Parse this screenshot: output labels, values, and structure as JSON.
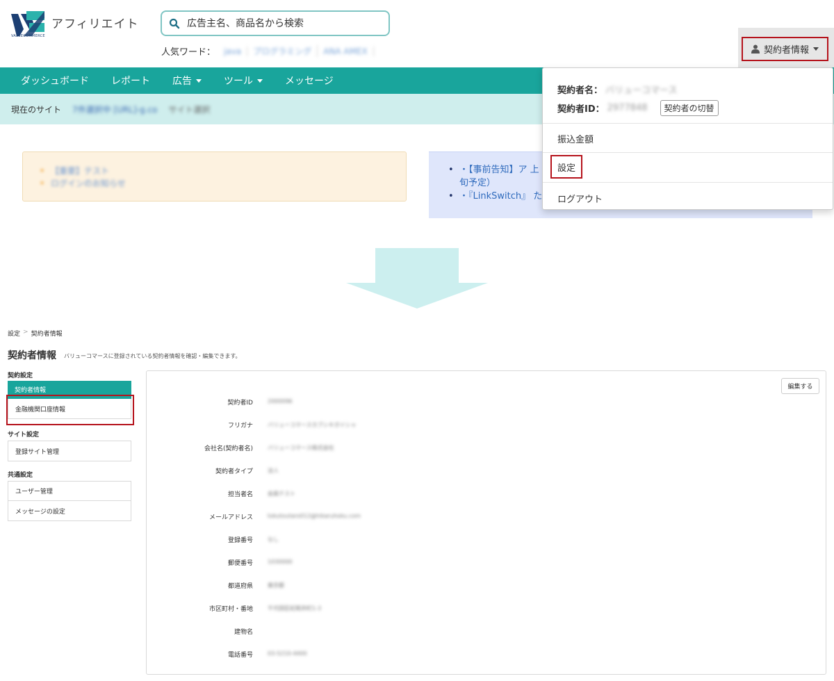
{
  "header": {
    "logo_text": "アフィリエイト",
    "logo_sub": "VALUECOMMERCE",
    "search_placeholder": "広告主名、商品名から検索",
    "popular_label": "人気ワード：",
    "popular_words": [
      "java",
      "プログラミング",
      "ANA AMEX"
    ],
    "account_label": "契約者情報"
  },
  "nav": {
    "items": [
      "ダッシュボード",
      "レポート",
      "広告",
      "ツール",
      "メッセージ"
    ]
  },
  "sitebar": {
    "label": "現在のサイト",
    "site_name": "7件選択中  [URL]-g.co",
    "site_select": "サイト選択"
  },
  "notices_left": [
    "【重要】テスト",
    "ログインのお知らせ"
  ],
  "notices_right": [
    "・【事前告知】ア 上旬予定）",
    "・『LinkSwitch』 た"
  ],
  "dropdown": {
    "name_label": "契約者名：",
    "name_value": "バリューコマース",
    "id_label": "契約者ID：",
    "id_value": "2977848",
    "switch_label": "契約者の切替",
    "transfer": "振込金額",
    "settings": "設定",
    "logout": "ログアウト"
  },
  "breadcrumb": {
    "root": "設定",
    "sep": ">",
    "current": "契約者情報"
  },
  "page": {
    "title": "契約者情報",
    "description": "バリューコマースに登録されている契約者情報を確認・編集できます。"
  },
  "sidebar": {
    "contract_heading": "契約設定",
    "contract_items": [
      "契約者情報",
      "金融機関口座情報"
    ],
    "site_heading": "サイト設定",
    "site_items": [
      "登録サイト管理"
    ],
    "common_heading": "共通設定",
    "common_items": [
      "ユーザー管理",
      "メッセージの設定"
    ]
  },
  "detail": {
    "edit_button": "編集する",
    "fields": [
      {
        "label": "契約者ID",
        "value": "2000096"
      },
      {
        "label": "フリガナ",
        "value": "バリューコマースカブシキガイシャ"
      },
      {
        "label": "会社名(契約者名)",
        "value": "バリューコマース株式会社"
      },
      {
        "label": "契約者タイプ",
        "value": "法人"
      },
      {
        "label": "担当者名",
        "value": "会員テスト"
      },
      {
        "label": "メールアドレス",
        "value": "tokutoutaro012@hikaruhoku.com"
      },
      {
        "label": "登録番号",
        "value": "なし"
      },
      {
        "label": "郵便番号",
        "value": "1030000"
      },
      {
        "label": "都道府県",
        "value": "東京都"
      },
      {
        "label": "市区町村・番地",
        "value": "千代田区紀尾井町1-3"
      },
      {
        "label": "建物名",
        "value": ""
      },
      {
        "label": "電話番号",
        "value": "03-5210-4400"
      }
    ]
  },
  "colors": {
    "brand_teal": "#19a59c",
    "highlight_red": "#b5121b",
    "site_bar": "#cfeeed"
  }
}
